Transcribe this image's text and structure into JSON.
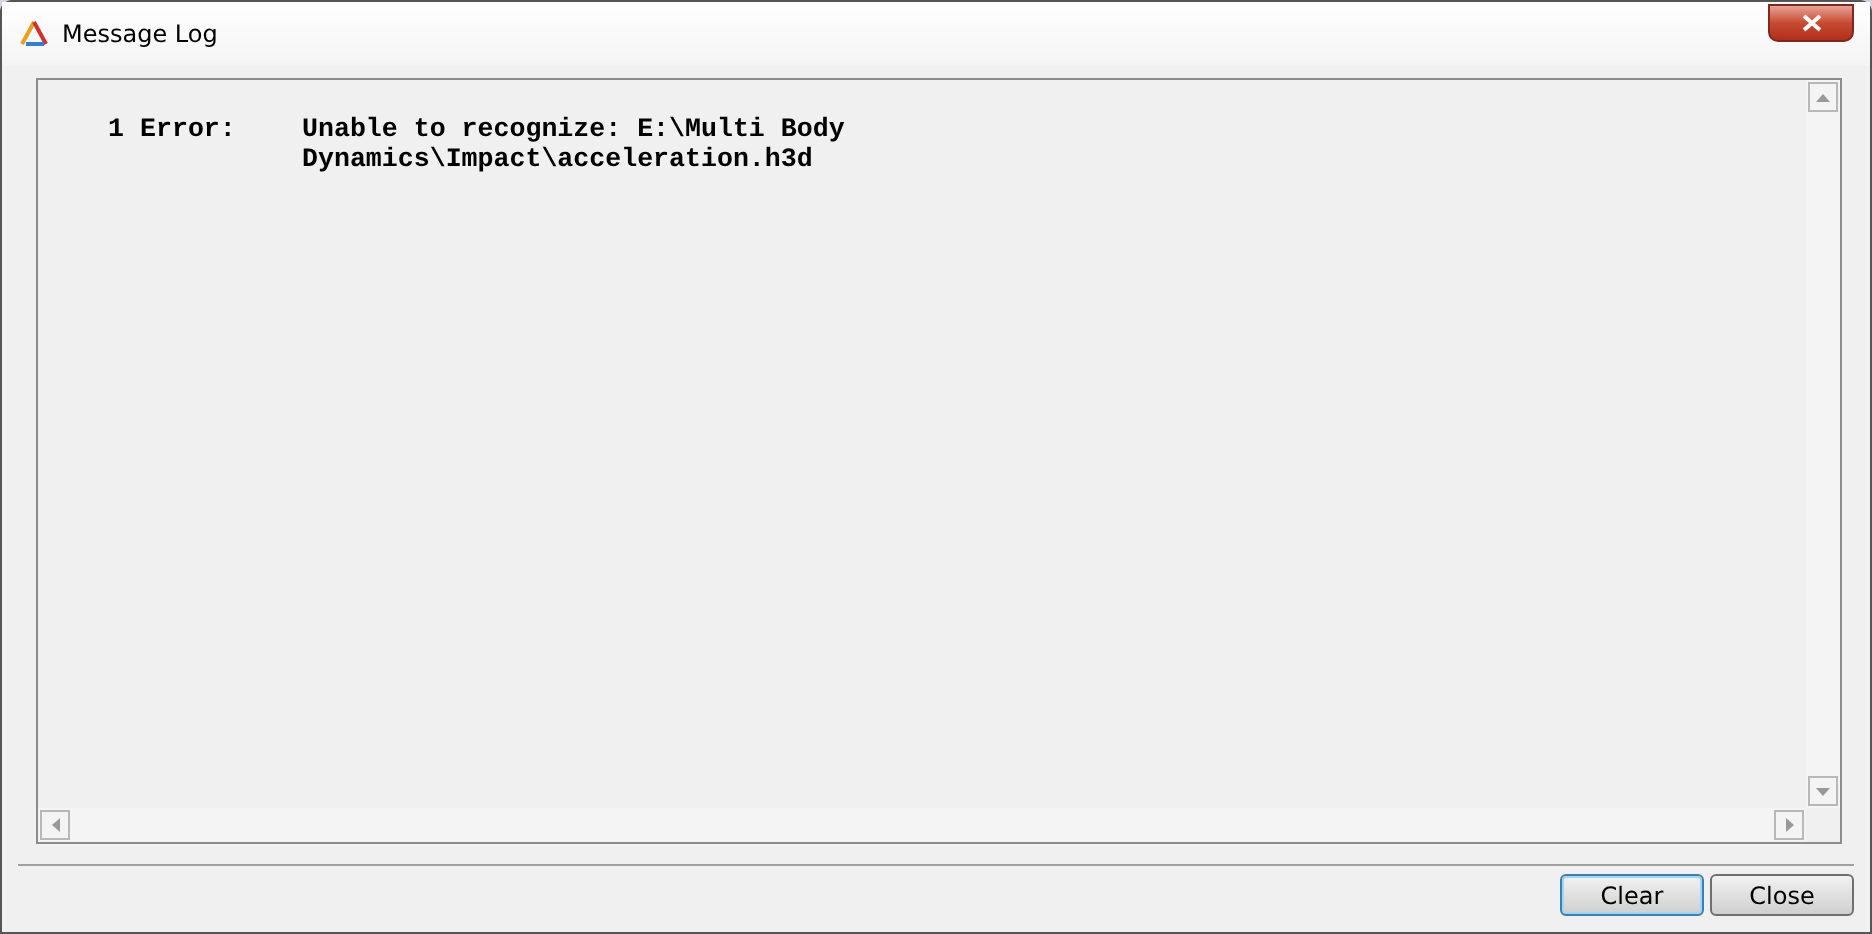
{
  "window": {
    "title": "Message Log"
  },
  "messages": [
    {
      "number": "1",
      "label": "Error:",
      "text": "Unable to recognize: E:\\Multi Body Dynamics\\Impact\\acceleration.h3d"
    }
  ],
  "buttons": [
    {
      "label": "Clear",
      "default": true
    },
    {
      "label": "Close",
      "default": false
    }
  ]
}
